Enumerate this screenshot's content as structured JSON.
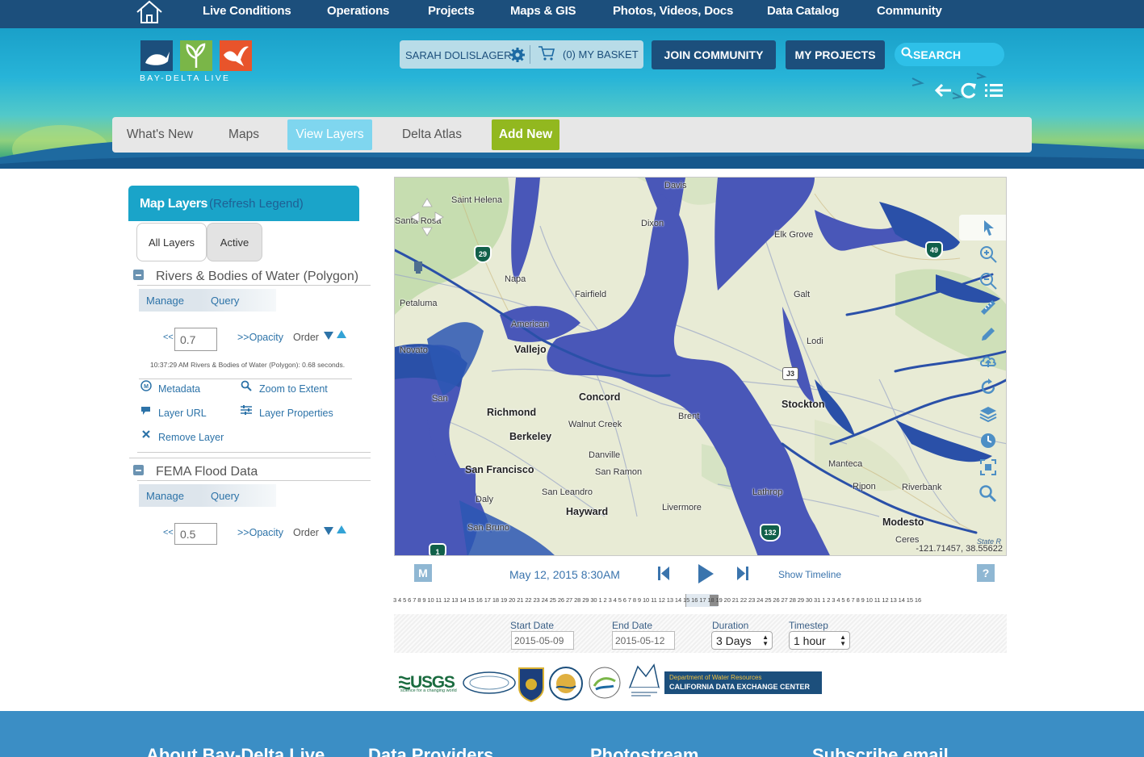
{
  "nav": {
    "home_icon": "house-icon",
    "links": [
      "Live Conditions",
      "Operations",
      "Projects",
      "Maps & GIS",
      "Photos, Videos, Docs",
      "Data Catalog",
      "Community"
    ]
  },
  "brand": {
    "logo_text": "BAY-DELTA LIVE",
    "tile_colors": [
      "#1c4f7c",
      "#7ab648",
      "#e8542b"
    ]
  },
  "user_bar": {
    "user_name": "SARAH DOLISLAGER",
    "settings_icon": "gear-icon",
    "cart_icon": "cart-icon",
    "basket_label": "(0) MY BASKET",
    "join_label": "JOIN COMMUNITY",
    "projects_label": "MY PROJECTS",
    "search_placeholder": "SEARCH",
    "util_icons": [
      "back-arrow-icon",
      "refresh-icon",
      "list-icon"
    ]
  },
  "subnav": {
    "tabs": [
      "What's New",
      "Maps",
      "View Layers",
      "Delta Atlas",
      "Add New"
    ],
    "active": "View Layers",
    "colors": {
      "active": "#7fd6ef",
      "add_new": "#92b81f"
    }
  },
  "sidebar": {
    "title": "Map Layers",
    "refresh_link": "(Refresh Legend)",
    "filter_tabs": [
      "All Layers",
      "Active"
    ],
    "layers": [
      {
        "name": "Rivers & Bodies of Water (Polygon)",
        "tabs": [
          "Manage",
          "Query"
        ],
        "opacity_left": "<<",
        "opacity": "0.7",
        "opacity_right": ">>Opacity",
        "order_label": "Order",
        "load_message": "10:37:29 AM Rivers & Bodies of Water (Polygon): 0.68 seconds.",
        "actions": [
          "Metadata",
          "Zoom to Extent",
          "Layer URL",
          "Layer Properties",
          "Remove Layer"
        ]
      },
      {
        "name": "FEMA Flood Data",
        "tabs": [
          "Manage",
          "Query"
        ],
        "opacity_left": "<<",
        "opacity": "0.5",
        "opacity_right": ">>Opacity",
        "order_label": "Order"
      }
    ]
  },
  "map": {
    "cities": [
      "Saint Helena",
      "Davis",
      "Dixon",
      "Elk Grove",
      "Napa",
      "Fairfield",
      "Galt",
      "Petaluma",
      "American",
      "Vallejo",
      "Novato",
      "Lodi",
      "Concord",
      "Richmond",
      "Walnut Creek",
      "Brent",
      "Stockton",
      "Berkeley",
      "Danville",
      "San Francisco",
      "San Ramon",
      "Manteca",
      "Ripon",
      "Riverbank",
      "San Leandro",
      "Livermore",
      "Hayward",
      "Modesto",
      "San Bruno",
      "Ceres",
      "Santa Rosa",
      "San",
      "Daly",
      "Lathrop"
    ],
    "highways": [
      "29",
      "49",
      "J3",
      "132",
      "1"
    ],
    "coordinates": "-121.71457, 38.55622",
    "attribution": "State R",
    "tools": [
      "pointer-icon",
      "zoom-in-icon",
      "zoom-out-icon",
      "measure-ruler-icon",
      "draw-pencil-icon",
      "cloud-upload-icon",
      "refresh-icon",
      "layers-icon",
      "clock-icon",
      "full-extent-icon",
      "search-icon"
    ],
    "colors": {
      "water": "#4957b8",
      "river": "#2a50a8",
      "land": "#e8ebd5",
      "green": "#c6ddb0"
    }
  },
  "timeline": {
    "m_label": "M",
    "datetime": "May 12, 2015 8:30AM",
    "show_label": "Show Timeline",
    "help_label": "?",
    "ticks": "3 4 5 6 7 8 9 10 11 12 13 14 15 16 17 18 19 20 21 22 23 24 25 26 27 28 29 30 1  2 3 4 5 6 7 8 9 10 11 12 13 14 15 16 17 18 19 20 21 22 23 24 25 26 27 28 29 30 31  1 2 3 4 5 6 7 8 9 10 11 12 13 14 15 16",
    "start_label": "Start Date",
    "start_value": "2015-05-09",
    "end_label": "End Date",
    "end_value": "2015-05-12",
    "duration_label": "Duration",
    "duration_value": "3 Days",
    "timestep_label": "Timestep",
    "timestep_value": "1 hour"
  },
  "partners": {
    "usgs": "USGS",
    "usgs_tagline": "science for a changing world",
    "dwr_line1": "Department of Water Resources",
    "dwr_line2": "CALIFORNIA DATA EXCHANGE CENTER",
    "seal_icons": [
      "bureau-of-reclamation-seal-icon",
      "california-dfw-badge-icon",
      "water-board-seal-icon",
      "delta-stewardship-seal-icon",
      "swamp-logo-icon"
    ]
  },
  "footer": {
    "headings": [
      "About Bay-Delta Live",
      "Data Providers",
      "Photostream",
      "Subscribe email"
    ]
  }
}
